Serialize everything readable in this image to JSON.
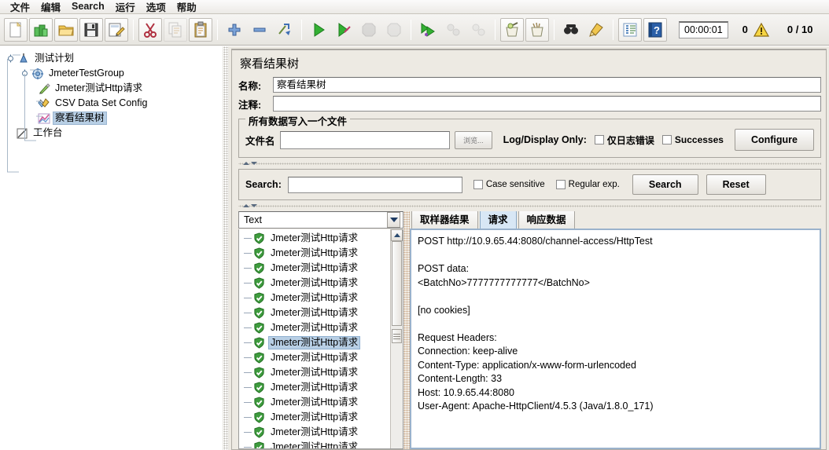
{
  "menu": {
    "items": [
      {
        "label": "文件",
        "name": "menu-file"
      },
      {
        "label": "编辑",
        "name": "menu-edit"
      },
      {
        "label": "Search",
        "name": "menu-search"
      },
      {
        "label": "运行",
        "name": "menu-run"
      },
      {
        "label": "选项",
        "name": "menu-options"
      },
      {
        "label": "帮助",
        "name": "menu-help"
      }
    ]
  },
  "toolbar": {
    "timer": "00:00:01",
    "warning_count": "0",
    "thread_count": "0 / 10",
    "icons": [
      "new-document-icon",
      "new-test-plan-icon",
      "open-folder-icon",
      "save-icon",
      "save-as-icon",
      "cut-icon",
      "copy-icon",
      "paste-icon",
      "expand-all-icon",
      "collapse-all-icon",
      "toggle-icon",
      "start-icon",
      "start-no-timers-icon",
      "stop-icon",
      "shutdown-icon",
      "start-remote-icon",
      "stop-remote-icon",
      "shutdown-remote-icon",
      "clear-icon",
      "clear-all-icon",
      "search-icon",
      "search-reset-icon",
      "function-helper-icon",
      "help-icon"
    ]
  },
  "tree": {
    "nodes": [
      {
        "label": "测试计划",
        "icon": "test-plan-icon",
        "indent": 0,
        "selected": false,
        "name": "tree-node-test-plan"
      },
      {
        "label": "JmeterTestGroup",
        "icon": "thread-group-icon",
        "indent": 1,
        "selected": false,
        "name": "tree-node-thread-group"
      },
      {
        "label": "Jmeter测试Http请求",
        "icon": "http-sampler-icon",
        "indent": 2,
        "selected": false,
        "name": "tree-node-http-request"
      },
      {
        "label": "CSV Data Set Config",
        "icon": "csv-config-icon",
        "indent": 2,
        "selected": false,
        "name": "tree-node-csv-config"
      },
      {
        "label": "察看结果树",
        "icon": "view-results-tree-icon",
        "indent": 2,
        "selected": true,
        "name": "tree-node-view-results-tree"
      },
      {
        "label": "工作台",
        "icon": "workbench-icon",
        "indent": 0,
        "selected": false,
        "name": "tree-node-workbench"
      }
    ]
  },
  "panel": {
    "title": "察看结果树",
    "name_label": "名称:",
    "name_value": "察看结果树",
    "comment_label": "注释:",
    "comment_value": "",
    "file_group_title": "所有数据写入一个文件",
    "filename_label": "文件名",
    "filename_value": "",
    "browse_button": "浏览...",
    "log_display_only_label": "Log/Display Only:",
    "errors_only_label": "仅日志错误",
    "errors_only_checked": false,
    "successes_label": "Successes",
    "successes_checked": false,
    "configure_button": "Configure"
  },
  "search": {
    "label": "Search:",
    "value": "",
    "case_sensitive_label": "Case sensitive",
    "case_sensitive_checked": false,
    "regular_exp_label": "Regular exp.",
    "regular_exp_checked": false,
    "search_button": "Search",
    "reset_button": "Reset"
  },
  "results": {
    "renderer_selected": "Text",
    "sampler_label": "Jmeter测试Http请求",
    "items": [
      {
        "label": "Jmeter测试Http请求",
        "status": "success",
        "selected": false
      },
      {
        "label": "Jmeter测试Http请求",
        "status": "success",
        "selected": false
      },
      {
        "label": "Jmeter测试Http请求",
        "status": "success",
        "selected": false
      },
      {
        "label": "Jmeter测试Http请求",
        "status": "success",
        "selected": false
      },
      {
        "label": "Jmeter测试Http请求",
        "status": "success",
        "selected": false
      },
      {
        "label": "Jmeter测试Http请求",
        "status": "success",
        "selected": false
      },
      {
        "label": "Jmeter测试Http请求",
        "status": "success",
        "selected": false
      },
      {
        "label": "Jmeter测试Http请求",
        "status": "success",
        "selected": true
      },
      {
        "label": "Jmeter测试Http请求",
        "status": "success",
        "selected": false
      },
      {
        "label": "Jmeter测试Http请求",
        "status": "success",
        "selected": false
      },
      {
        "label": "Jmeter测试Http请求",
        "status": "success",
        "selected": false
      },
      {
        "label": "Jmeter测试Http请求",
        "status": "success",
        "selected": false
      },
      {
        "label": "Jmeter测试Http请求",
        "status": "success",
        "selected": false
      },
      {
        "label": "Jmeter测试Http请求",
        "status": "success",
        "selected": false
      },
      {
        "label": "Jmeter测试Http请求",
        "status": "success",
        "selected": false
      }
    ],
    "tabs": [
      {
        "label": "取样器结果",
        "active": false,
        "name": "tab-sampler-result"
      },
      {
        "label": "请求",
        "active": true,
        "name": "tab-request"
      },
      {
        "label": "响应数据",
        "active": false,
        "name": "tab-response-data"
      }
    ],
    "request_text": "POST http://10.9.65.44:8080/channel-access/HttpTest\n\nPOST data:\n<BatchNo>7777777777777</BatchNo>\n\n[no cookies]\n\nRequest Headers:\nConnection: keep-alive\nContent-Type: application/x-www-form-urlencoded\nContent-Length: 33\nHost: 10.9.65.44:8080\nUser-Agent: Apache-HttpClient/4.5.3 (Java/1.8.0_171)"
  },
  "colors": {
    "accent": "#b8cfe5",
    "panel_bg": "#edeae3",
    "success_green": "#3e9b3e",
    "warning_yellow": "#f2c12e",
    "tab_active": "#d8e7f5"
  }
}
